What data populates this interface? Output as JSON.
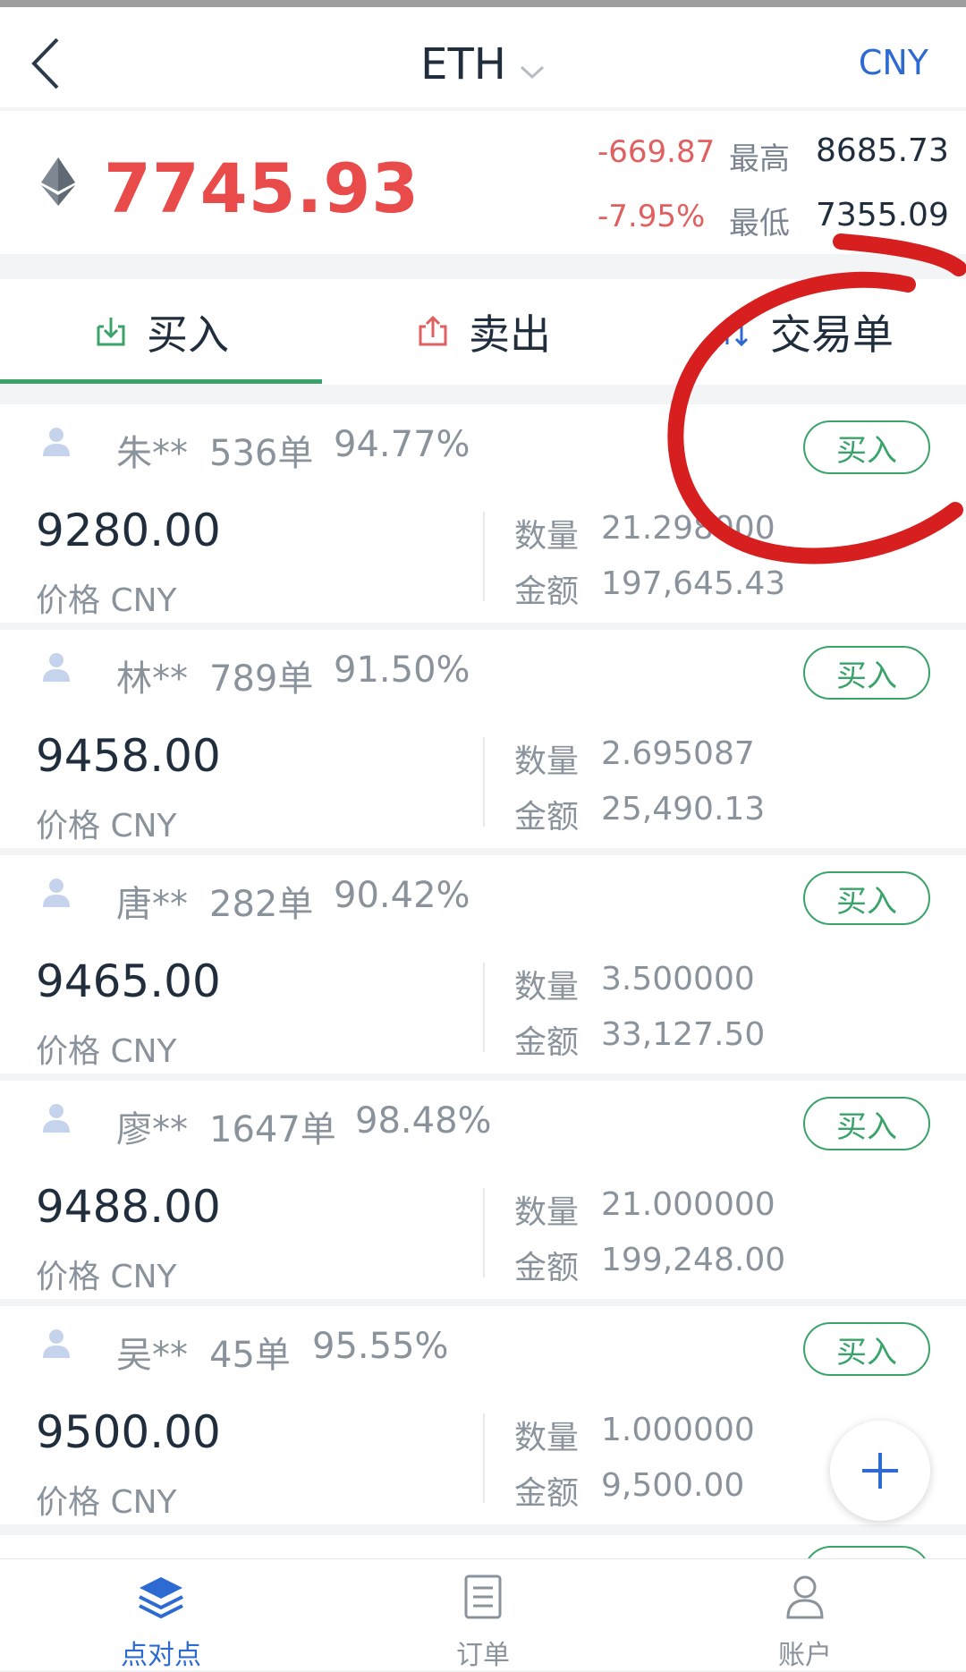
{
  "header": {
    "title": "ETH",
    "currency_toggle": "CNY"
  },
  "ticker": {
    "price": "7745.93",
    "change_amount": "-669.87",
    "change_percent": "-7.95%",
    "high_label": "最高",
    "high_value": "8685.73",
    "low_label": "最低",
    "low_value": "7355.09"
  },
  "tabs": [
    {
      "label": "买入",
      "icon": "download-icon",
      "active": true
    },
    {
      "label": "卖出",
      "icon": "upload-icon",
      "active": false
    },
    {
      "label": "交易单",
      "icon": "exchange-icon",
      "active": false
    }
  ],
  "listing_labels": {
    "price_label": "价格 CNY",
    "quantity_label": "数量",
    "amount_label": "金额",
    "buy_button": "买入"
  },
  "listings": [
    {
      "name": "朱**",
      "orders": "536单",
      "rate": "94.77%",
      "price": "9280.00",
      "quantity": "21.298000",
      "amount": "197,645.43"
    },
    {
      "name": "林**",
      "orders": "789单",
      "rate": "91.50%",
      "price": "9458.00",
      "quantity": "2.695087",
      "amount": "25,490.13"
    },
    {
      "name": "唐**",
      "orders": "282单",
      "rate": "90.42%",
      "price": "9465.00",
      "quantity": "3.500000",
      "amount": "33,127.50"
    },
    {
      "name": "廖**",
      "orders": "1647单",
      "rate": "98.48%",
      "price": "9488.00",
      "quantity": "21.000000",
      "amount": "199,248.00"
    },
    {
      "name": "吴**",
      "orders": "45单",
      "rate": "95.55%",
      "price": "9500.00",
      "quantity": "1.000000",
      "amount": "9,500.00"
    }
  ],
  "bottom_nav": [
    {
      "label": "点对点",
      "icon": "layers-icon",
      "active": true
    },
    {
      "label": "订单",
      "icon": "document-icon",
      "active": false
    },
    {
      "label": "账户",
      "icon": "person-icon",
      "active": false
    }
  ],
  "colors": {
    "accent_green": "#3aa36a",
    "price_red": "#e94a4a",
    "brand_blue": "#2d6bd3",
    "annotation_red": "#d81f1f"
  }
}
